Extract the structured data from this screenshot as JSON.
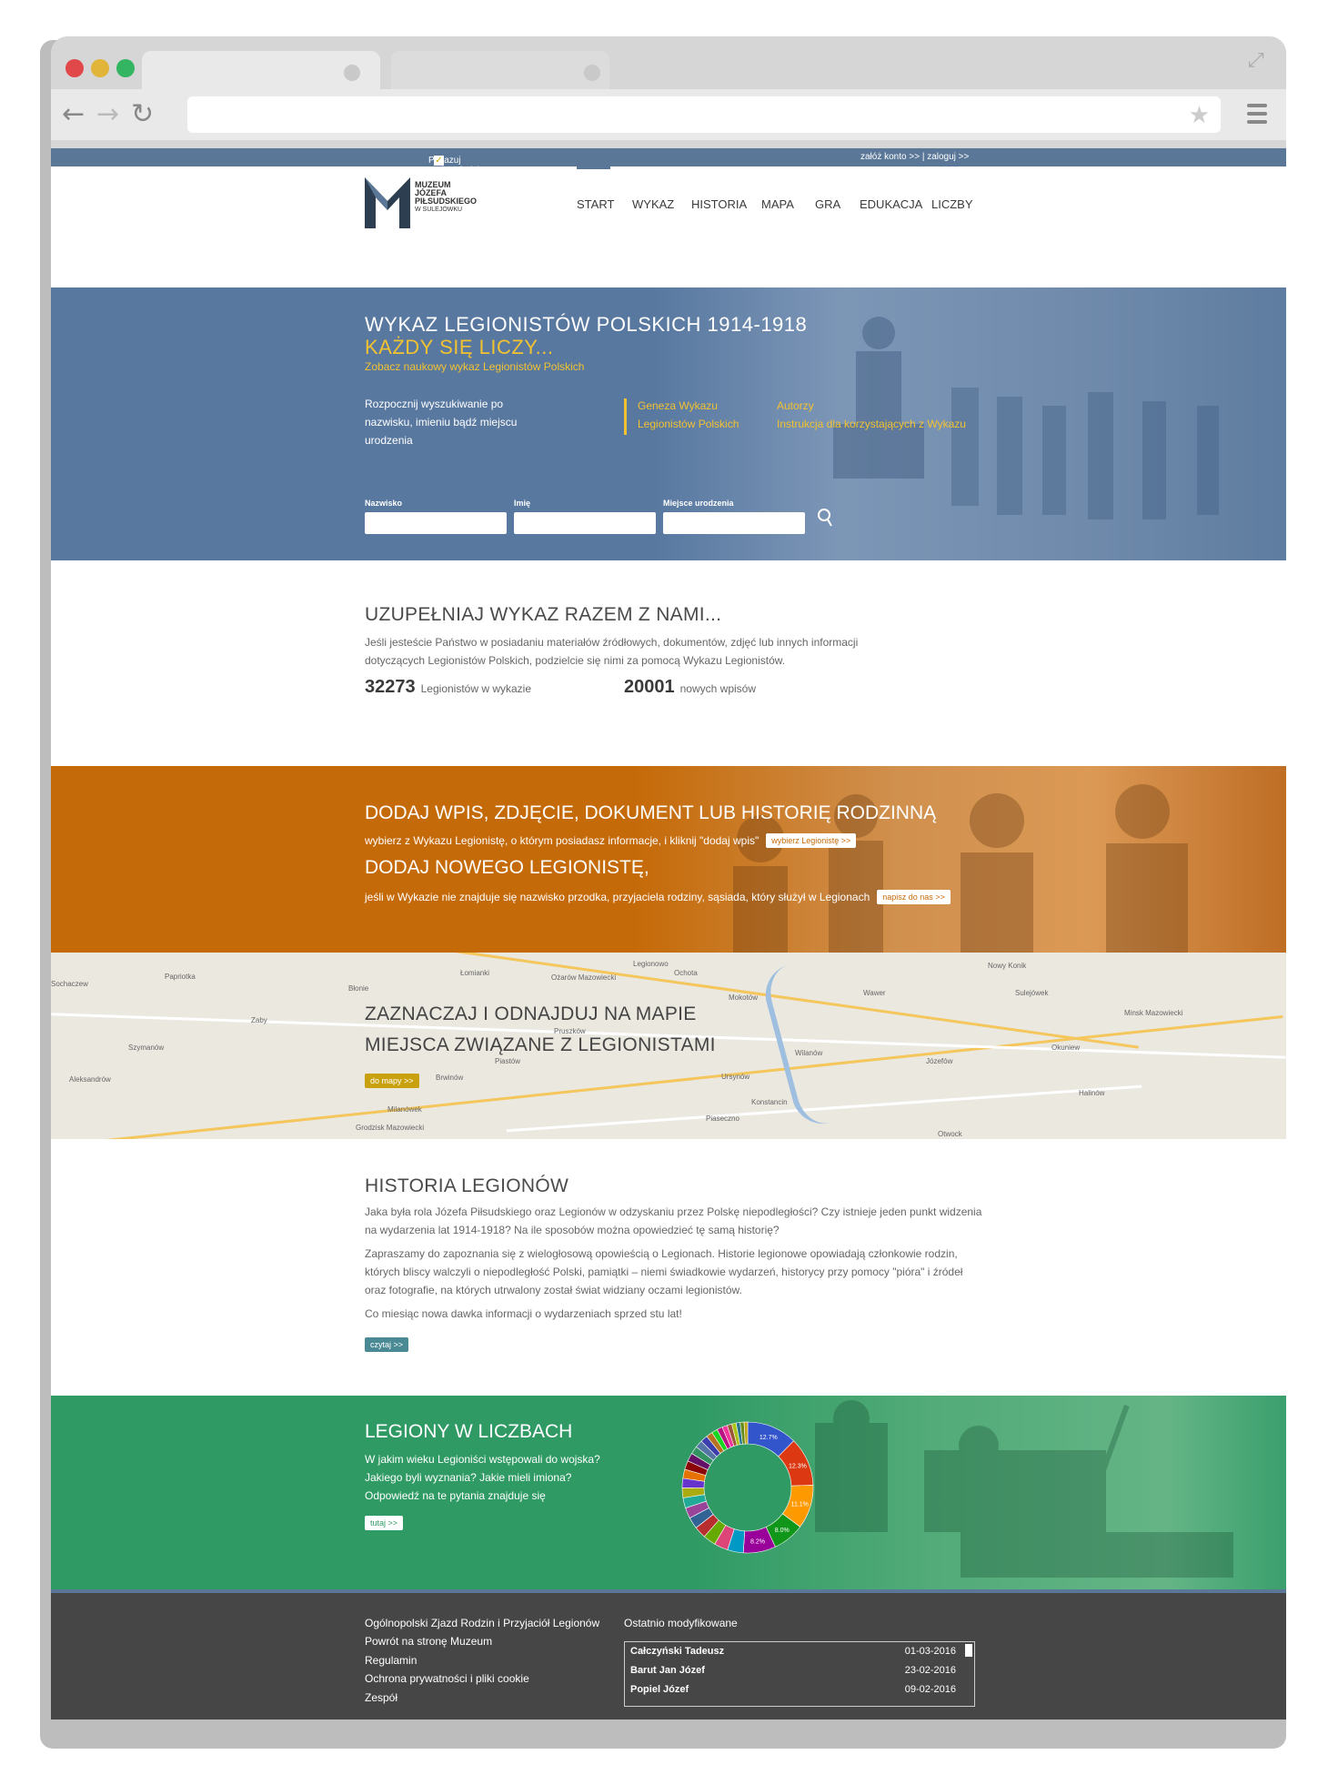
{
  "topbar": {
    "hints_label": "Pokazuj podpowiedzi",
    "hints_check": "✓",
    "account_links": "załóż konto >> | zaloguj >>"
  },
  "logo": {
    "line1": "MUZEUM",
    "line2": "JÓZEFA",
    "line3": "PIŁSUDSKIEGO",
    "line4": "W SULEJÓWKU"
  },
  "nav": {
    "items": [
      "START",
      "WYKAZ",
      "HISTORIA",
      "MAPA",
      "GRA",
      "EDUKACJA",
      "LICZBY"
    ],
    "active": "START"
  },
  "hero": {
    "title": "WYKAZ LEGIONISTÓW POLSKICH 1914-1918",
    "subtitle": "KAŻDY SIĘ LICZY...",
    "tagline": "Zobacz naukowy wykaz Legionistów Polskich",
    "intro": "Rozpocznij wyszukiwanie po nazwisku, imieniu bądź miejscu urodzenia",
    "link1a": "Geneza Wykazu",
    "link1b": "Legionistów Polskich",
    "link2a": "Autorzy",
    "link2b": "Instrukcja dla korzystających z Wykazu",
    "label_surname": "Nazwisko",
    "label_name": "Imię",
    "label_birthplace": "Miejsce urodzenia"
  },
  "contribute": {
    "title": "UZUPEŁNIAJ WYKAZ RAZEM Z NAMI...",
    "text": "Jeśli jesteście Państwo w posiadaniu materiałów źródłowych, dokumentów, zdjęć lub innych informacji dotyczących Legionistów Polskich, podzielcie się nimi za pomocą Wykazu Legionistów.",
    "count1": "32273",
    "count1_label": "Legionistów w wykazie",
    "count2": "20001",
    "count2_label": "nowych wpisów"
  },
  "add": {
    "title1": "DODAJ WPIS, ZDJĘCIE, DOKUMENT LUB HISTORIĘ RODZINNĄ",
    "text1": "wybierz z Wykazu Legionistę, o którym posiadasz informacje, i kliknij \"dodaj wpis\"",
    "btn1": "wybierz Legionistę >>",
    "title2": "DODAJ NOWEGO LEGIONISTĘ,",
    "text2": "jeśli w Wykazie nie znajduje się nazwisko przodka, przyjaciela rodziny, sąsiada, który służył w Legionach",
    "btn2": "napisz do nas >>"
  },
  "map": {
    "title1": "ZAZNACZAJ I ODNAJDUJ NA MAPIE",
    "title2": "MIEJSCA ZWIĄZANE Z LEGIONISTAMI",
    "btn": "do mapy >>",
    "places": [
      "Papriotka",
      "Łomianki",
      "Ochota",
      "Mokotów",
      "Wawer",
      "Józefów",
      "Otwock",
      "Wilanów",
      "Ursynów",
      "Piaseczno",
      "Pruszków",
      "Piastów",
      "Błonie",
      "Milanówek",
      "Grodzisk Mazowiecki",
      "Brwinów",
      "Ożarów Mazowiecki",
      "Minsk Mazowiecki",
      "Szymanów",
      "Aleksandrów",
      "Sochaczew",
      "Zaby",
      "Konstancin",
      "Nowy Konik",
      "Sulejówek",
      "Halinów",
      "Okuniew",
      "Legionowo"
    ]
  },
  "history": {
    "title": "HISTORIA LEGIONÓW",
    "p1": "Jaka była rola Józefa Piłsudskiego oraz Legionów w odzyskaniu przez Polskę niepodległości? Czy istnieje jeden punkt widzenia na wydarzenia lat 1914-1918? Na ile sposobów można opowiedzieć tę samą historię?",
    "p2": "Zapraszamy do zapoznania się z wielogłosową opowieścią o Legionach. Historie legionowe opowiadają członkowie rodzin, których bliscy walczyli o niepodległość Polski, pamiątki – niemi świadkowie wydarzeń, historycy przy pomocy \"pióra\" i źródeł oraz fotografie, na których utrwalony został świat widziany oczami legionistów.",
    "p3": "Co miesiąc nowa dawka informacji o wydarzeniach sprzed stu lat!",
    "btn": "czytaj >>"
  },
  "numbers": {
    "title": "LEGIONY W LICZBACH",
    "q1": "W jakim wieku Legioniści wstępowali do wojska?",
    "q2": "Jakiego byli wyznania? Jakie mieli imiona?",
    "q3": "Odpowiedź na te pytania znajduje się",
    "btn": "tutaj >>"
  },
  "chart_data": {
    "type": "pie",
    "donut": true,
    "slices": [
      {
        "label": "12.7%",
        "value": 12.7,
        "color": "#3355cc"
      },
      {
        "label": "12.3%",
        "value": 12.3,
        "color": "#dc3912"
      },
      {
        "label": "11.1%",
        "value": 11.1,
        "color": "#ff9900"
      },
      {
        "label": "8.0%",
        "value": 8.0,
        "color": "#109618"
      },
      {
        "label": "8.2%",
        "value": 8.2,
        "color": "#990099"
      },
      {
        "label": "",
        "value": 4.0,
        "color": "#0099c6"
      },
      {
        "label": "",
        "value": 3.5,
        "color": "#dd4477"
      },
      {
        "label": "",
        "value": 3.2,
        "color": "#66aa00"
      },
      {
        "label": "",
        "value": 3.0,
        "color": "#b82e2e"
      },
      {
        "label": "",
        "value": 2.9,
        "color": "#316395"
      },
      {
        "label": "",
        "value": 2.7,
        "color": "#994499"
      },
      {
        "label": "",
        "value": 2.6,
        "color": "#22aa99"
      },
      {
        "label": "",
        "value": 2.5,
        "color": "#aaaa11"
      },
      {
        "label": "",
        "value": 2.4,
        "color": "#6633cc"
      },
      {
        "label": "",
        "value": 2.3,
        "color": "#e67300"
      },
      {
        "label": "",
        "value": 2.2,
        "color": "#8b0707"
      },
      {
        "label": "",
        "value": 2.1,
        "color": "#651067"
      },
      {
        "label": "",
        "value": 2.0,
        "color": "#329262"
      },
      {
        "label": "",
        "value": 1.9,
        "color": "#5574a6"
      },
      {
        "label": "",
        "value": 1.8,
        "color": "#3b3eac"
      },
      {
        "label": "",
        "value": 1.6,
        "color": "#b77322"
      },
      {
        "label": "",
        "value": 1.5,
        "color": "#16d620"
      },
      {
        "label": "",
        "value": 1.4,
        "color": "#b91383"
      },
      {
        "label": "",
        "value": 1.3,
        "color": "#f4359e"
      },
      {
        "label": "",
        "value": 1.2,
        "color": "#9c5935"
      },
      {
        "label": "",
        "value": 1.1,
        "color": "#a9c413"
      },
      {
        "label": "",
        "value": 1.0,
        "color": "#2a778d"
      },
      {
        "label": "",
        "value": 1.0,
        "color": "#668d1c"
      },
      {
        "label": "",
        "value": 0.9,
        "color": "#bea413"
      }
    ]
  },
  "footer": {
    "links": [
      "Ogólnopolski Zjazd Rodzin i Przyjaciół Legionów",
      "Powrót na stronę Muzeum",
      "Regulamin",
      "Ochrona prywatności i pliki cookie",
      "Zespół"
    ],
    "recent_title": "Ostatnio modyfikowane",
    "recent": [
      {
        "name": "Całczyński Tadeusz",
        "date": "01-03-2016"
      },
      {
        "name": "Barut Jan Józef",
        "date": "23-02-2016"
      },
      {
        "name": "Popiel Józef",
        "date": "09-02-2016"
      }
    ]
  },
  "colors": {
    "blue": "#5878a0",
    "orange": "#c56a08",
    "green": "#2f9a64",
    "yellow": "#f2c230",
    "footer": "#464646"
  }
}
